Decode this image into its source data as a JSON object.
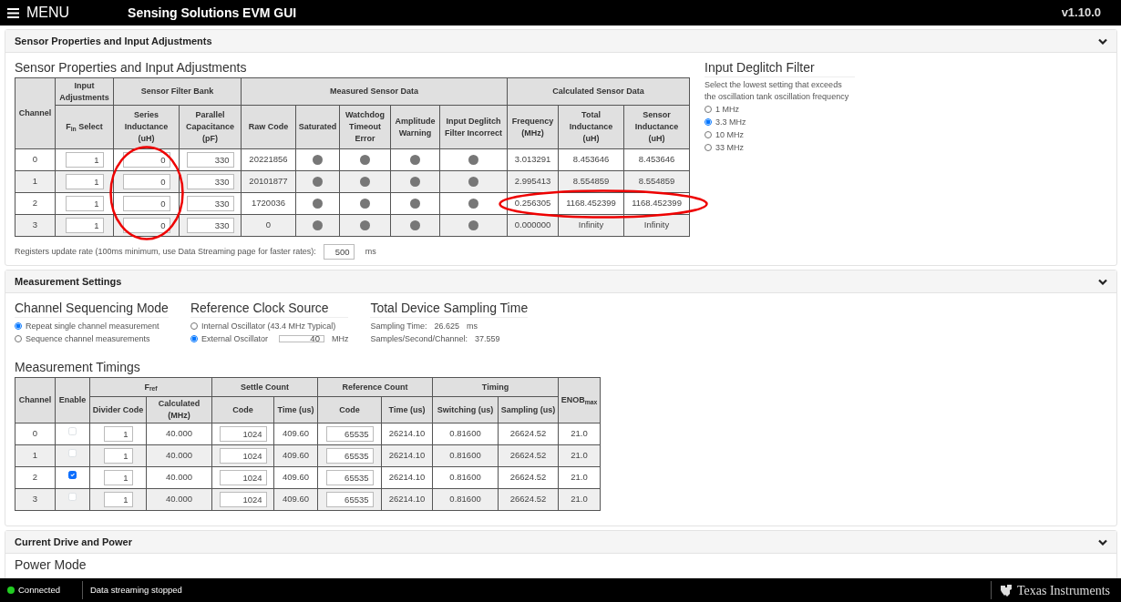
{
  "topbar": {
    "menu": "MENU",
    "title": "Sensing Solutions EVM GUI",
    "version": "v1.10.0"
  },
  "sensor_section": {
    "header": "Sensor Properties and Input Adjustments",
    "title": "Sensor Properties and Input Adjustments",
    "table": {
      "group_headers": [
        {
          "label": "Channel",
          "rowspan": 2
        },
        {
          "label": "Input Adjustments"
        },
        {
          "label": "Sensor Filter Bank",
          "colspan": 2
        },
        {
          "label": "Measured Sensor Data",
          "colspan": 5
        },
        {
          "label": "Calculated Sensor Data",
          "colspan": 3
        }
      ],
      "columns": [
        "F$_{in}$ Select",
        "Series Inductance (uH)",
        "Parallel Capacitance (pF)",
        "Raw Code",
        "Saturated",
        "Watchdog Timeout Error",
        "Amplitude Warning",
        "Input Deglitch Filter Incorrect",
        "Frequency (MHz)",
        "Total Inductance (uH)",
        "Sensor Inductance (uH)"
      ],
      "rows": [
        {
          "channel": "0",
          "fin_select": "1",
          "series_inductance": "0",
          "parallel_capacitance": "330",
          "raw_code": "20221856",
          "saturated": false,
          "watchdog": false,
          "amplitude": false,
          "deglitch": false,
          "frequency": "3.013291",
          "total_inductance": "8.453646",
          "sensor_inductance": "8.453646",
          "series_circled": true,
          "calculated_circled": false
        },
        {
          "channel": "1",
          "fin_select": "1",
          "series_inductance": "0",
          "parallel_capacitance": "330",
          "raw_code": "20101877",
          "saturated": false,
          "watchdog": false,
          "amplitude": false,
          "deglitch": false,
          "frequency": "2.995413",
          "total_inductance": "8.554859",
          "sensor_inductance": "8.554859",
          "series_circled": true,
          "calculated_circled": false
        },
        {
          "channel": "2",
          "fin_select": "1",
          "series_inductance": "0",
          "parallel_capacitance": "330",
          "raw_code": "1720036",
          "saturated": false,
          "watchdog": false,
          "amplitude": false,
          "deglitch": false,
          "frequency": "0.256305",
          "total_inductance": "1168.452399",
          "sensor_inductance": "1168.452399",
          "series_circled": true,
          "calculated_circled": true
        },
        {
          "channel": "3",
          "fin_select": "1",
          "series_inductance": "0",
          "parallel_capacitance": "330",
          "raw_code": "0",
          "saturated": false,
          "watchdog": false,
          "amplitude": false,
          "deglitch": false,
          "frequency": "0.000000",
          "total_inductance": "Infinity",
          "sensor_inductance": "Infinity",
          "series_circled": true,
          "calculated_circled": false
        }
      ]
    },
    "update_rate": {
      "label": "Registers update rate (100ms minimum, use Data Streaming page for faster rates):",
      "value": "500",
      "unit": "ms"
    },
    "deglitch": {
      "title": "Input Deglitch Filter",
      "hint": "Select the lowest setting that exceeds the oscillation tank oscillation frequency",
      "options": [
        {
          "label": "1 MHz",
          "selected": false
        },
        {
          "label": "3.3 MHz",
          "selected": true
        },
        {
          "label": "10 MHz",
          "selected": false
        },
        {
          "label": "33 MHz",
          "selected": false
        }
      ]
    }
  },
  "measurement_section": {
    "header": "Measurement Settings",
    "sequencing": {
      "title": "Channel Sequencing Mode",
      "options": [
        {
          "label": "Repeat single channel measurement",
          "selected": true
        },
        {
          "label": "Sequence channel measurements",
          "selected": false
        }
      ]
    },
    "clock": {
      "title": "Reference Clock Source",
      "options": [
        {
          "label": "Internal Oscillator (43.4 MHz Typical)",
          "selected": false
        },
        {
          "label": "External Oscillator",
          "selected": true,
          "value": "40",
          "unit": "MHz"
        }
      ]
    },
    "sampling": {
      "title": "Total Device Sampling Time",
      "lines": [
        {
          "label": "Sampling Time:",
          "value": "26.625",
          "unit": "ms"
        },
        {
          "label": "Samples/Second/Channel:",
          "value": "37.559"
        }
      ]
    },
    "timings": {
      "title": "Measurement Timings",
      "group_headers": [
        {
          "label": "Channel",
          "rowspan": 2
        },
        {
          "label": "Enable",
          "rowspan": 2
        },
        {
          "label": "F$_{ref}$",
          "colspan": 2
        },
        {
          "label": "Settle Count",
          "colspan": 2
        },
        {
          "label": "Reference Count",
          "colspan": 2
        },
        {
          "label": "Timing",
          "colspan": 2
        },
        {
          "label": "ENOB$_{max}$",
          "rowspan": 2
        }
      ],
      "columns": [
        "Divider Code",
        "Calculated (MHz)",
        "Code",
        "Time (us)",
        "Code",
        "Time (us)",
        "Switching (us)",
        "Sampling (us)"
      ],
      "rows": [
        {
          "channel": "0",
          "enabled": false,
          "divider_code": "1",
          "calculated": "40.000",
          "settle_code": "1024",
          "settle_time": "409.60",
          "reference_code": "65535",
          "reference_time": "26214.10",
          "switching": "0.81600",
          "sampling": "26624.52",
          "enob": "21.0"
        },
        {
          "channel": "1",
          "enabled": false,
          "divider_code": "1",
          "calculated": "40.000",
          "settle_code": "1024",
          "settle_time": "409.60",
          "reference_code": "65535",
          "reference_time": "26214.10",
          "switching": "0.81600",
          "sampling": "26624.52",
          "enob": "21.0"
        },
        {
          "channel": "2",
          "enabled": true,
          "divider_code": "1",
          "calculated": "40.000",
          "settle_code": "1024",
          "settle_time": "409.60",
          "reference_code": "65535",
          "reference_time": "26214.10",
          "switching": "0.81600",
          "sampling": "26624.52",
          "enob": "21.0"
        },
        {
          "channel": "3",
          "enabled": false,
          "divider_code": "1",
          "calculated": "40.000",
          "settle_code": "1024",
          "settle_time": "409.60",
          "reference_code": "65535",
          "reference_time": "26214.10",
          "switching": "0.81600",
          "sampling": "26624.52",
          "enob": "21.0"
        }
      ]
    }
  },
  "power_section": {
    "header": "Current Drive and Power",
    "title": "Power Mode"
  },
  "status_bar": {
    "connected": true,
    "connection": "Connected",
    "streaming": "Data streaming stopped",
    "logo": "Texas Instruments"
  }
}
